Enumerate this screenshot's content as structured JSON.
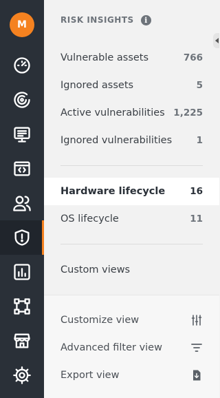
{
  "user": {
    "initial": "M"
  },
  "nav": [
    {
      "icon": "dashboard-gauge-icon"
    },
    {
      "icon": "scan-icon"
    },
    {
      "icon": "monitor-list-icon"
    },
    {
      "icon": "code-window-icon"
    },
    {
      "icon": "users-icon"
    },
    {
      "icon": "shield-alert-icon",
      "active": true
    },
    {
      "icon": "reports-chart-icon"
    },
    {
      "icon": "workflow-nodes-icon"
    },
    {
      "icon": "store-icon"
    },
    {
      "icon": "settings-gear-icon"
    }
  ],
  "panel": {
    "title": "RISK INSIGHTS",
    "info_icon": "i",
    "insights": [
      {
        "label": "Vulnerable assets",
        "count": "766"
      },
      {
        "label": "Ignored assets",
        "count": "5"
      },
      {
        "label": "Active vulnerabilities",
        "count": "1,225"
      },
      {
        "label": "Ignored vulnerabilities",
        "count": "1"
      }
    ],
    "lifecycle": [
      {
        "label": "Hardware lifecycle",
        "count": "16",
        "selected": true
      },
      {
        "label": "OS lifecycle",
        "count": "11"
      }
    ],
    "custom_views_label": "Custom views",
    "actions": [
      {
        "label": "Customize view",
        "icon": "sliders-icon"
      },
      {
        "label": "Advanced filter view",
        "icon": "filter-icon"
      },
      {
        "label": "Export view",
        "icon": "export-file-icon"
      }
    ]
  },
  "colors": {
    "rail_bg": "#2a3038",
    "accent": "#f58220",
    "panel_bg": "#f2f2f2",
    "selected_bg": "#ffffff"
  }
}
